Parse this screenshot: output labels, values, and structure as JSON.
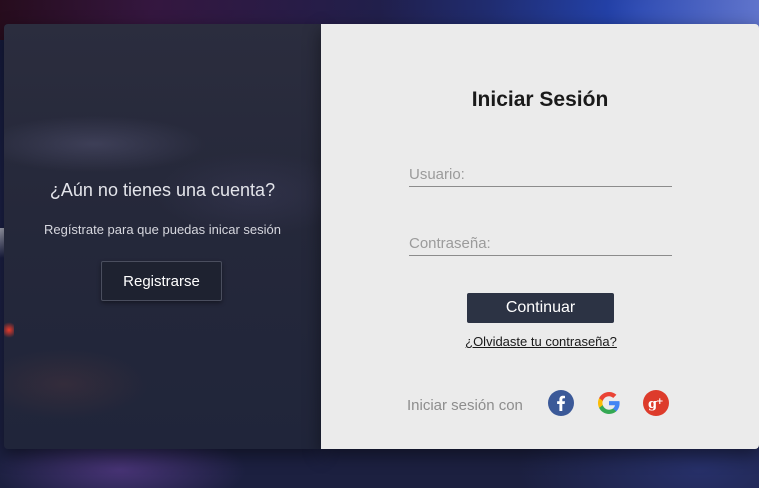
{
  "signup": {
    "title": "¿Aún no tienes una cuenta?",
    "subtitle": "Regístrate para que puedas inicar sesión",
    "button_label": "Registrarse"
  },
  "login": {
    "title": "Iniciar Sesión",
    "username": {
      "value": "",
      "placeholder": "Usuario:"
    },
    "password": {
      "value": "",
      "placeholder": "Contraseña:"
    },
    "continue_label": "Continuar",
    "forgot_label": "¿Olvidaste tu contraseña?",
    "social_label": "Iniciar sesión con",
    "social_icons": [
      "facebook-icon",
      "google-icon",
      "google-plus-icon"
    ]
  },
  "colors": {
    "panel_light": "#ebebeb",
    "panel_dark": "#25283a",
    "button_dark": "#2c3344",
    "facebook": "#3b5998",
    "google_plus": "#dd3b2b"
  }
}
